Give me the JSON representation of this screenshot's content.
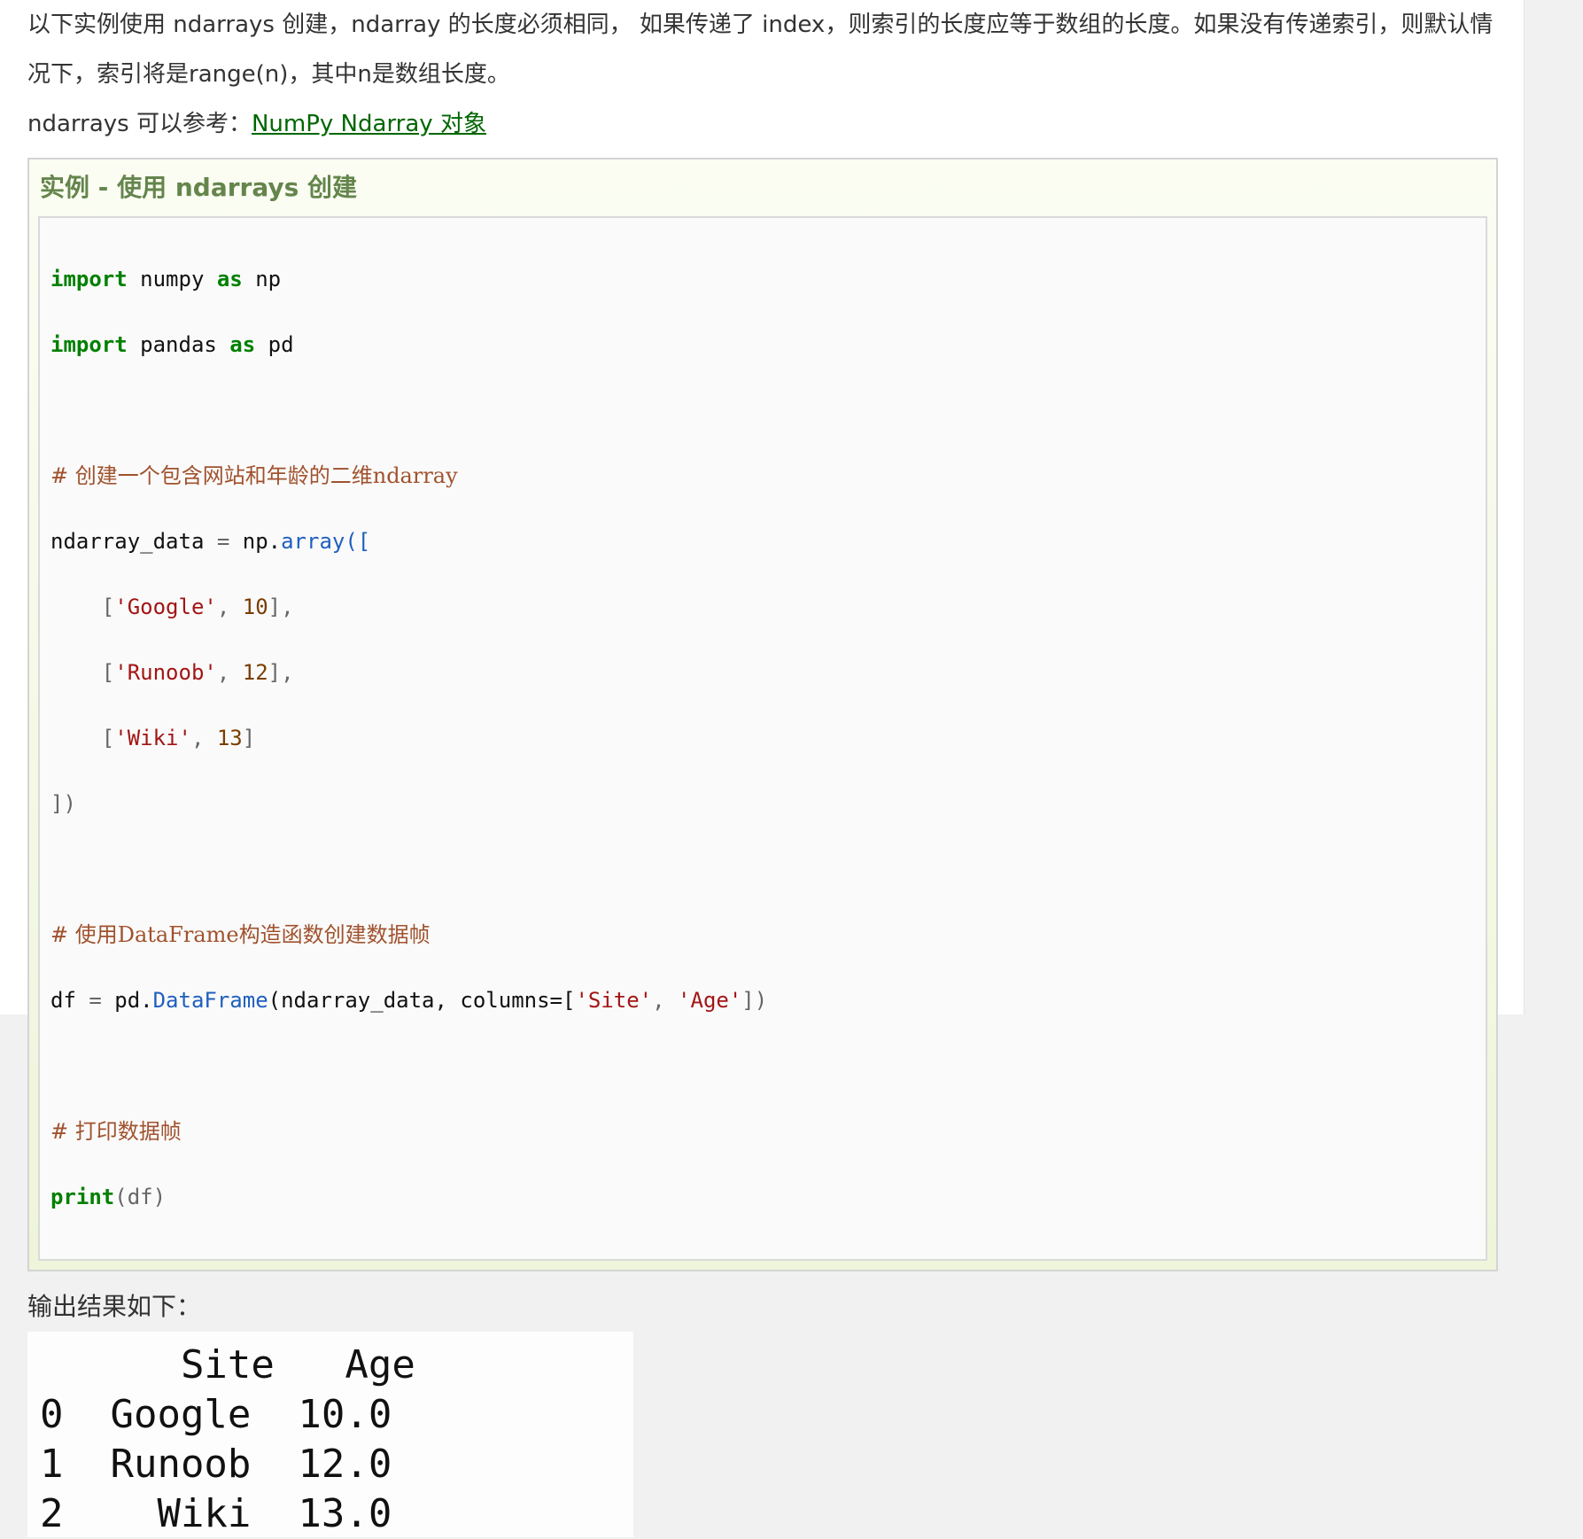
{
  "intro": {
    "text": "以下实例使用 ndarrays 创建，ndarray 的长度必须相同， 如果传递了 index，则索引的长度应等于数组的长度。如果没有传递索引，则默认情况下，索引将是range(n)，其中n是数组长度。"
  },
  "reference": {
    "prefix": "ndarrays 可以参考：",
    "link_text": "NumPy Ndarray 对象"
  },
  "example": {
    "title": "实例 - 使用 ndarrays 创建",
    "code": {
      "l1": {
        "kw1": "import",
        "mod": " numpy ",
        "kw2": "as",
        "alias": " np"
      },
      "l2": {
        "kw1": "import",
        "mod": " pandas ",
        "kw2": "as",
        "alias": " pd"
      },
      "c1": "# 创建一个包含网站和年龄的二维ndarray",
      "l3": {
        "a": "ndarray_data ",
        "eq": "=",
        "b": " np.",
        "fn": "array",
        "c": "(["
      },
      "r1": {
        "open": "    [",
        "str": "'Google'",
        "sep": ", ",
        "num": "10",
        "close": "],"
      },
      "r2": {
        "open": "    [",
        "str": "'Runoob'",
        "sep": ", ",
        "num": "12",
        "close": "],"
      },
      "r3": {
        "open": "    [",
        "str": "'Wiki'",
        "sep": ", ",
        "num": "13",
        "close": "]"
      },
      "end": "])",
      "c2": "# 使用DataFrame构造函数创建数据帧",
      "l4": {
        "a": "df ",
        "eq": "=",
        "b": " pd.",
        "fn": "DataFrame",
        "c": "(ndarray_data, columns=[",
        "s1": "'Site'",
        "sep": ", ",
        "s2": "'Age'",
        "d": "])"
      },
      "c3": "# 打印数据帧",
      "l5": {
        "fn": "print",
        "c": "(df)"
      }
    }
  },
  "output": {
    "label": "输出结果如下：",
    "lines": [
      "      Site   Age",
      "0  Google  10.0",
      "1  Runoob  12.0",
      "2    Wiki  13.0"
    ]
  }
}
